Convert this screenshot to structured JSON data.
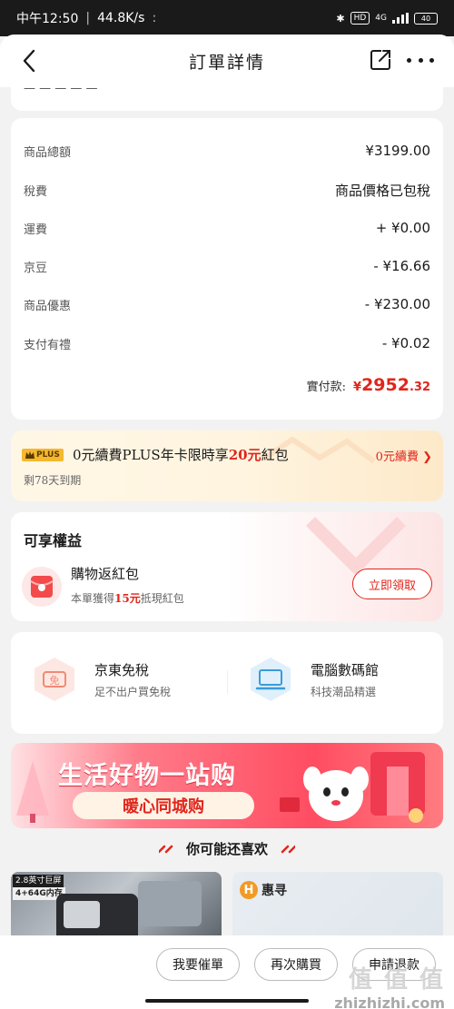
{
  "statusbar": {
    "time": "中午12:50",
    "speed": "44.8K/s",
    "net_label": "HD",
    "signal_label": "4G",
    "battery": "40"
  },
  "header": {
    "title": "訂單詳情"
  },
  "top_card": {
    "cut_text": "—   —   — — —"
  },
  "price": {
    "rows": [
      {
        "label": "商品總額",
        "value": "¥3199.00"
      },
      {
        "label": "稅費",
        "value": "商品價格已包稅"
      },
      {
        "label": "運費",
        "value": "+ ¥0.00"
      },
      {
        "label": "京豆",
        "value": "- ¥16.66"
      },
      {
        "label": "商品優惠",
        "value": "- ¥230.00"
      },
      {
        "label": "支付有禮",
        "value": "- ¥0.02"
      }
    ],
    "paid_label": "實付款:",
    "paid_currency": "¥",
    "paid_int": "2952",
    "paid_dec": ".32"
  },
  "plus": {
    "badge": "PLUS",
    "text_pre": "0元續費PLUS年卡限時享",
    "text_highlight": "20元",
    "text_post": "紅包",
    "sub": "剩78天到期",
    "cta": "0元續費"
  },
  "benefit": {
    "title": "可享權益",
    "name": "購物返紅包",
    "desc_pre": "本單獲得",
    "desc_highlight": "15元",
    "desc_post": "抵現紅包",
    "button": "立即領取"
  },
  "services": [
    {
      "name": "京東免稅",
      "desc": "足不出户買免稅",
      "icon": "duty-free-icon"
    },
    {
      "name": "電腦數碼館",
      "desc": "科技潮品精選",
      "icon": "laptop-icon"
    }
  ],
  "banner": {
    "title": "生活好物一站购",
    "pill": "暖心同城购"
  },
  "recommend": {
    "title": "你可能还喜欢"
  },
  "products": [
    {
      "tag1": "2.8英寸巨屏",
      "tag2": "4+64G内存"
    },
    {
      "brand": "惠寻",
      "brand_letter": "H"
    }
  ],
  "bottom": {
    "buttons": [
      "我要催單",
      "再次購買",
      "申請退款"
    ]
  },
  "watermark": {
    "text": "值 值 值",
    "url": "zhizhizhi.com"
  },
  "colors": {
    "accent": "#e1251b",
    "plus_gold": "#f5b82e"
  }
}
